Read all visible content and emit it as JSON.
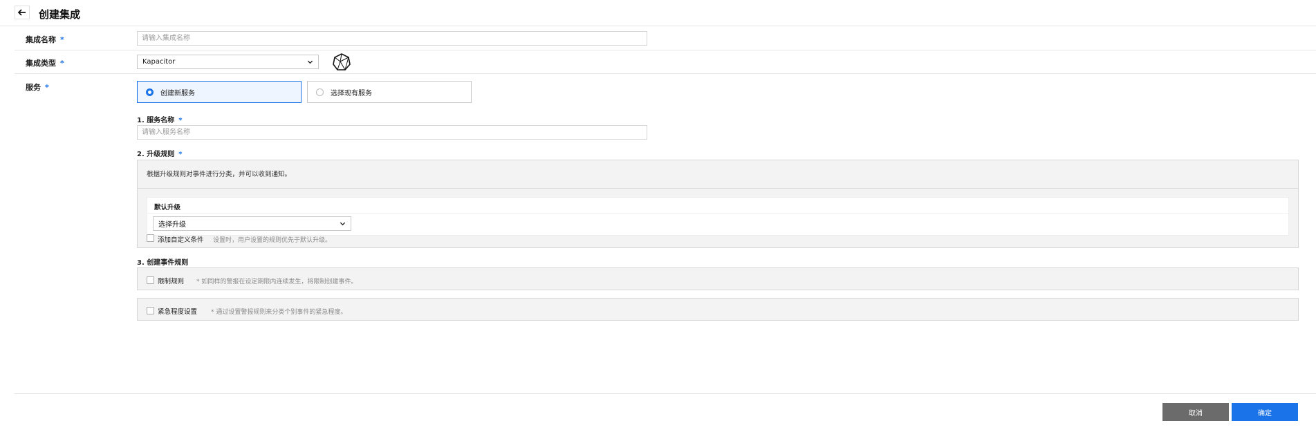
{
  "header": {
    "title": "创建集成"
  },
  "form": {
    "name": {
      "label": "集成名称",
      "required": "*",
      "placeholder": "请输入集成名称"
    },
    "type": {
      "label": "集成类型",
      "required": "*",
      "value": "Kapacitor"
    },
    "service": {
      "label": "服务",
      "required": "*",
      "options": [
        {
          "label": "创建新服务",
          "selected": true
        },
        {
          "label": "选择现有服务",
          "selected": false
        }
      ]
    },
    "service_name": {
      "label": "1. 服务名称",
      "required": "*",
      "placeholder": "请输入服务名称"
    },
    "escalation": {
      "label": "2. 升级规则",
      "required": "*",
      "description": "根据升级规则对事件进行分类，并可以收到通知。",
      "default_title": "默认升级",
      "select_value": "选择升级",
      "custom_label": "添加自定义条件",
      "custom_note": "设置时，用户设置的规则优先于默认升级。"
    },
    "event_rules": {
      "label": "3. 创建事件规则",
      "limit_label": "限制规则",
      "limit_note": "* 如同样的警报在设定期限内连续发生，将限制创建事件。",
      "urgency_label": "紧急程度设置",
      "urgency_note": "* 通过设置警报规则来分类个别事件的紧急程度。"
    }
  },
  "footer": {
    "cancel_label": "取消",
    "ok_label": "确定"
  },
  "colors": {
    "accent": "#1a73e8",
    "cancel": "#6b6b6b"
  }
}
